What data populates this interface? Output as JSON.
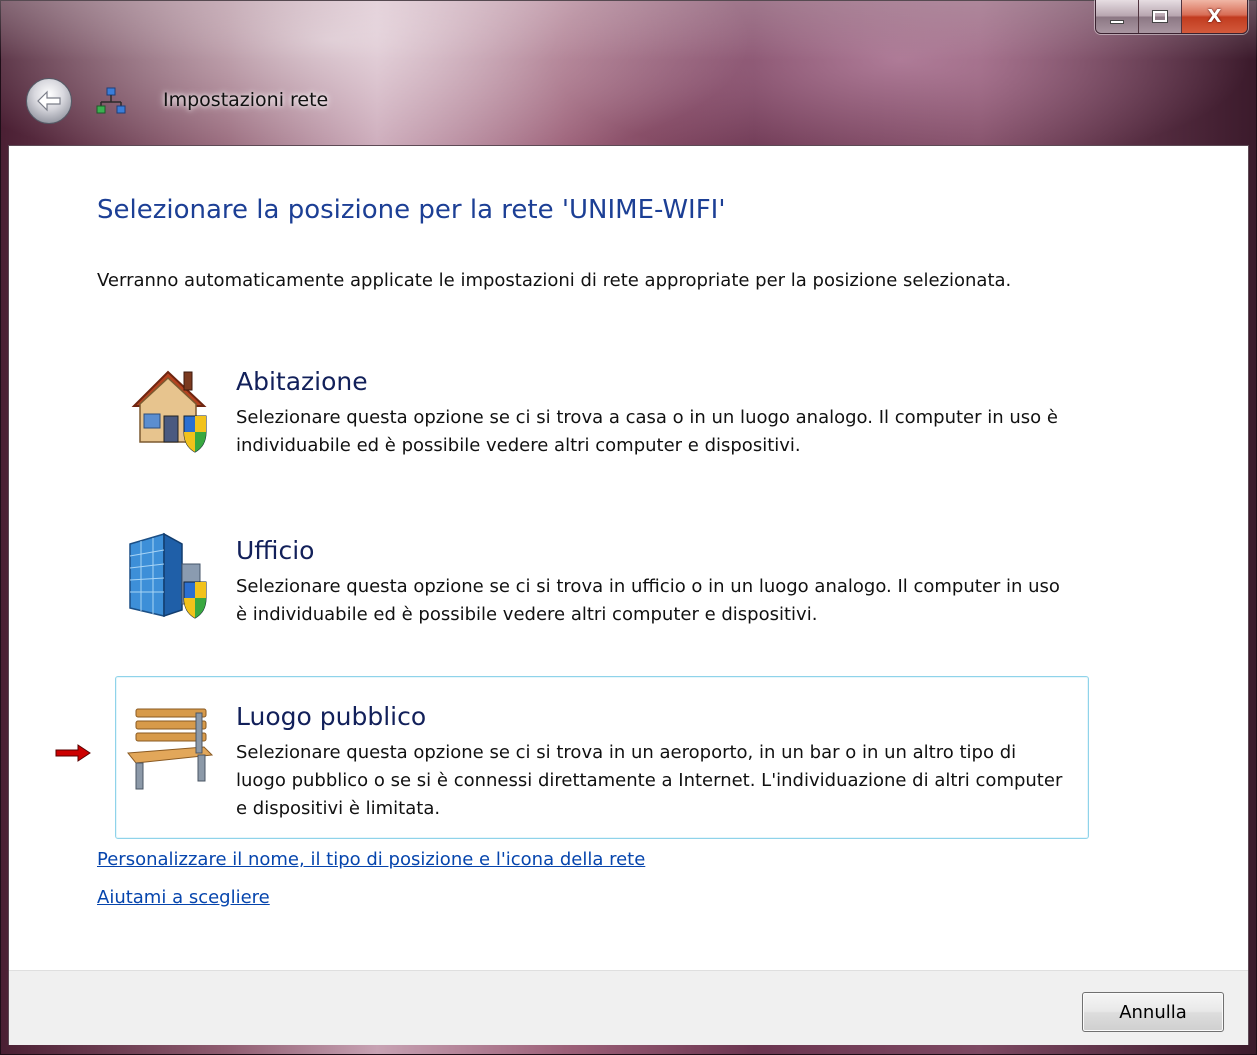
{
  "window": {
    "title": "Impostazioni rete",
    "close_glyph": "X",
    "caption_icons": [
      "minimize-icon",
      "maximize-icon",
      "close-icon"
    ]
  },
  "main": {
    "heading": "Selezionare la posizione per la rete 'UNIME-WIFI'",
    "intro": "Verranno automaticamente applicate le impostazioni di rete appropriate per la posizione selezionata.",
    "options": [
      {
        "title": "Abitazione",
        "description": "Selezionare questa opzione se ci si trova a casa o in un luogo analogo. Il computer in uso è individuabile ed è possibile vedere altri computer e dispositivi.",
        "icon": "house-shield-icon",
        "selected": false
      },
      {
        "title": "Ufficio",
        "description": "Selezionare questa opzione se ci si trova in ufficio o in un luogo analogo. Il computer in uso è individuabile ed è possibile vedere altri computer e dispositivi.",
        "icon": "office-building-shield-icon",
        "selected": false
      },
      {
        "title": "Luogo pubblico",
        "description": "Selezionare questa opzione se ci si trova in un aeroporto, in un bar o in un altro tipo di luogo pubblico o se si è connessi direttamente a Internet. L'individuazione di altri computer e dispositivi è limitata.",
        "icon": "park-bench-icon",
        "selected": true
      }
    ],
    "links": {
      "customize": "Personalizzare il nome, il tipo di posizione e l'icona della rete",
      "help": "Aiutami a scegliere"
    }
  },
  "footer": {
    "cancel_label": "Annulla"
  },
  "colors": {
    "heading": "#1c3f95",
    "link": "#0645ad",
    "selection_border": "#8fd3ea",
    "pointer_arrow": "#cc0000"
  }
}
